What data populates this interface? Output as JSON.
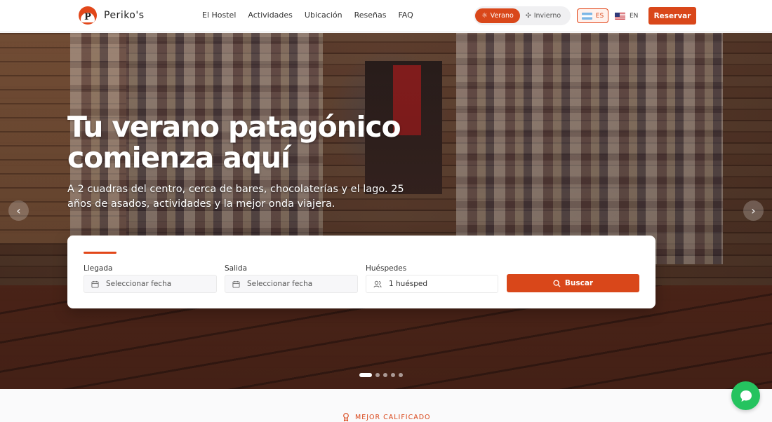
{
  "brand": {
    "name": "Periko's",
    "logo_letter": "P"
  },
  "nav": {
    "items": [
      "El Hostel",
      "Actividades",
      "Ubicación",
      "Reseñas",
      "FAQ"
    ]
  },
  "season_toggle": {
    "options": [
      "Verano",
      "Invierno"
    ],
    "selected": "Verano"
  },
  "languages": {
    "es": "ES",
    "en": "EN",
    "selected": "ES"
  },
  "header": {
    "cta_label": "Reservar"
  },
  "hero": {
    "title": "Tu verano patagónico comienza aquí",
    "subtitle": "A 2 cuadras del centro, cerca de bares, chocolaterías y el lago. 25 años de asados, actividades y la mejor onda viajera.",
    "slides_count": 5,
    "active_slide": 1
  },
  "search": {
    "arrival": {
      "label": "Llegada",
      "placeholder": "Seleccionar fecha"
    },
    "departure": {
      "label": "Salida",
      "placeholder": "Seleccionar fecha"
    },
    "guests": {
      "label": "Huéspedes",
      "value": "1 huésped"
    },
    "button_label": "Buscar"
  },
  "section": {
    "eyebrow": "MEJOR CALIFICADO"
  },
  "colors": {
    "accent": "#d9471a",
    "chat": "#25c35f"
  },
  "icons": [
    "sun-icon",
    "snowflake-icon",
    "calendar-icon",
    "users-icon",
    "search-icon",
    "award-icon",
    "chat-icon",
    "chevron-left-icon",
    "chevron-right-icon"
  ]
}
